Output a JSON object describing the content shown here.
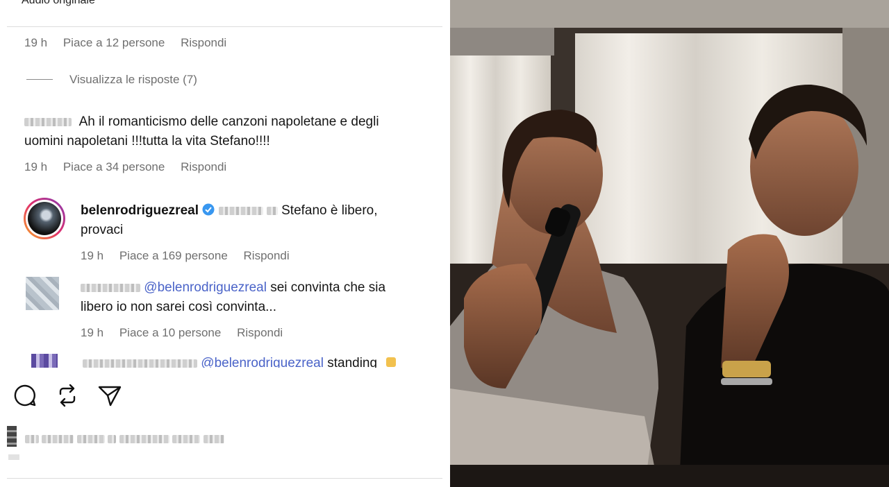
{
  "header": {
    "audio_label": "Audio originale"
  },
  "comments": [
    {
      "time": "19 h",
      "likes": "Piace a 12 persone",
      "reply": "Rispondi"
    },
    {
      "view_replies": "Visualizza le risposte (7)"
    },
    {
      "text_line1": "Ah il romanticismo delle canzoni napoletane e degli",
      "text_line2": "uomini napoletani !!!tutta la vita Stefano!!!!",
      "time": "19 h",
      "likes": "Piace a 34 persone",
      "reply": "Rispondi"
    },
    {
      "username": "belenrodriguezreal",
      "text_line1": "Stefano è libero,",
      "text_line2": "provaci",
      "time": "19 h",
      "likes": "Piace a 169 persone",
      "reply": "Rispondi"
    },
    {
      "mention": "@belenrodriguezreal",
      "text_line1": " sei convinta che sia",
      "text_line2": "libero io non sarei così convinta...",
      "time": "19 h",
      "likes": "Piace a 10 persone",
      "reply": "Rispondi"
    },
    {
      "mention": "@belenrodriguezreal",
      "text_partial": " standing"
    }
  ],
  "actions": {
    "icons": [
      "comment-icon",
      "repost-icon",
      "share-icon"
    ]
  },
  "colors": {
    "link": "#4a63c8",
    "verified": "#3897f0",
    "meta_gray": "#6f6f6f"
  }
}
